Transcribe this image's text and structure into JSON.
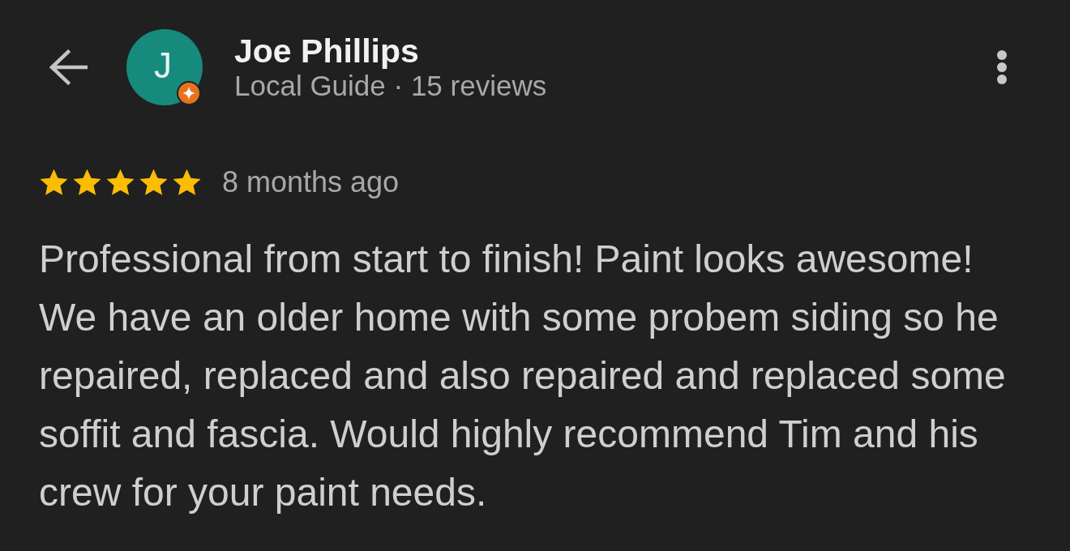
{
  "header": {
    "avatar": {
      "initial": "J",
      "color": "#168a7c",
      "local_guide_badge": true
    },
    "name": "Joe Phillips",
    "subtitle": "Local Guide · 15 reviews"
  },
  "review": {
    "stars": 5,
    "time": "8 months ago",
    "text": "Professional from start to finish! Paint looks awesome! We have an older home with some probem siding so he repaired, replaced and also repaired and replaced some soffit and fascia. Would highly recommend Tim and his crew for your paint needs."
  }
}
